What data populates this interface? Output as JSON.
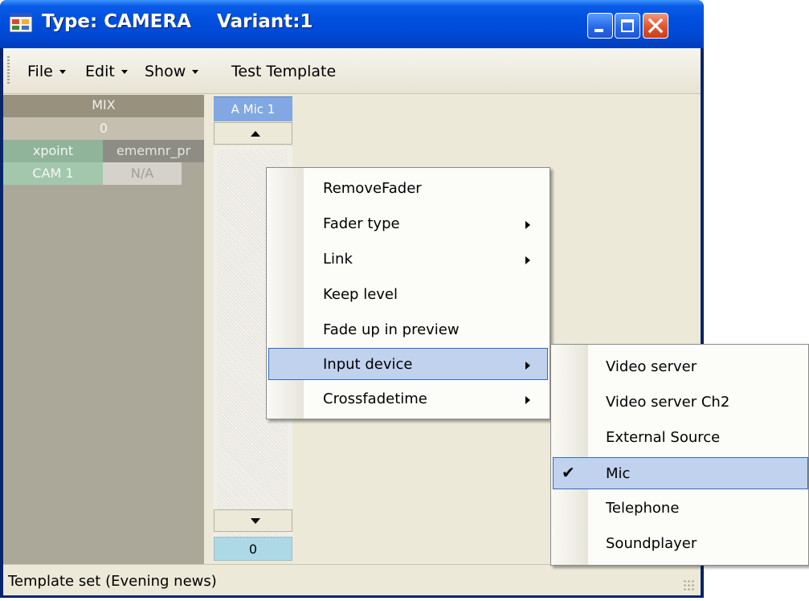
{
  "window": {
    "title": "Type: CAMERA    Variant:1",
    "minimize_label": "",
    "maximize_label": "",
    "close_label": ""
  },
  "menubar": {
    "items": [
      {
        "label": "File",
        "dropdown": true
      },
      {
        "label": "Edit",
        "dropdown": true
      },
      {
        "label": "Show",
        "dropdown": true
      },
      {
        "label": "Test Template",
        "dropdown": false
      }
    ]
  },
  "mix_panel": {
    "header": "MIX",
    "value": "0",
    "columns": [
      "xpoint",
      "ememnr_pr"
    ],
    "row": [
      "CAM 1",
      "N/A"
    ],
    "colors": {
      "xpoint": "#8fb49a",
      "ememnr_pr": "#8d8d86",
      "cam": "#a3c7ad",
      "na": "#d4d2cb"
    }
  },
  "fader": {
    "name": "A Mic 1",
    "value": "0"
  },
  "context_menu": {
    "items": [
      {
        "label": "RemoveFader",
        "submenu": false,
        "highlighted": false
      },
      {
        "label": "Fader type",
        "submenu": true,
        "highlighted": false
      },
      {
        "label": "Link",
        "submenu": true,
        "highlighted": false
      },
      {
        "label": "Keep level",
        "submenu": false,
        "highlighted": false
      },
      {
        "label": "Fade up in preview",
        "submenu": false,
        "highlighted": false
      },
      {
        "label": "Input device",
        "submenu": true,
        "highlighted": true
      },
      {
        "label": "Crossfadetime",
        "submenu": true,
        "highlighted": false
      }
    ]
  },
  "submenu": {
    "items": [
      {
        "label": "Video server",
        "checked": false
      },
      {
        "label": "Video server Ch2",
        "checked": false
      },
      {
        "label": "External Source",
        "checked": false
      },
      {
        "label": "Mic",
        "checked": true
      },
      {
        "label": "Telephone",
        "checked": false
      },
      {
        "label": "Soundplayer",
        "checked": false
      }
    ]
  },
  "statusbar": {
    "text": "Template set (Evening news)"
  }
}
